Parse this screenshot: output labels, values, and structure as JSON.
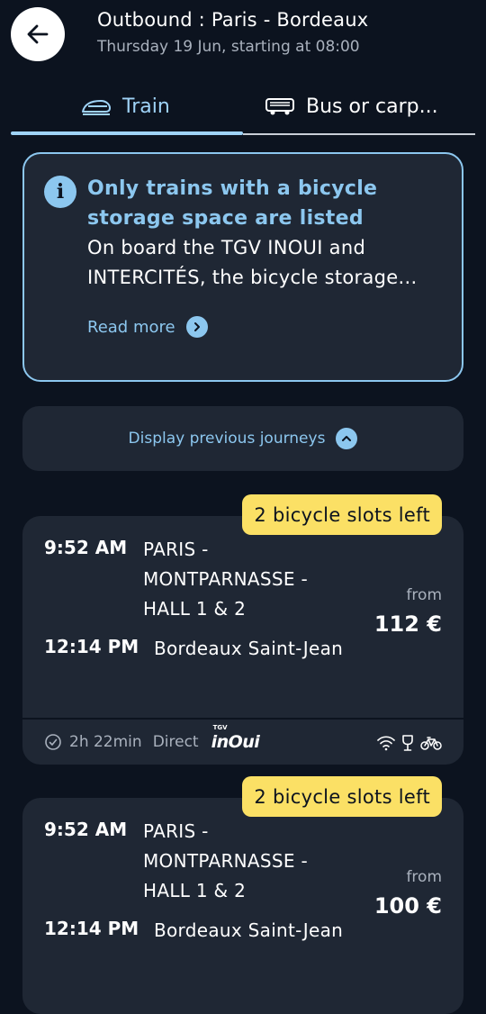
{
  "header": {
    "title": "Outbound : Paris - Bordeaux",
    "subtitle": "Thursday 19 Jun, starting at 08:00"
  },
  "tabs": [
    {
      "label": "Train",
      "icon": "train-icon",
      "active": true
    },
    {
      "label": "Bus or carp...",
      "icon": "bus-icon",
      "active": false
    }
  ],
  "info": {
    "title": "Only trains with a bicycle storage space are listed",
    "body": "On board the TGV INOUI and INTERCITÉS, the bicycle storage...",
    "read_more": "Read more"
  },
  "previous_journeys_label": "Display previous journeys",
  "journeys": [
    {
      "badge": "2 bicycle slots left",
      "departure_time": "9:52 AM",
      "departure_station": "PARIS - MONTPARNASSE - HALL 1 & 2",
      "arrival_time": "12:14 PM",
      "arrival_station": "Bordeaux Saint-Jean",
      "from_label": "from",
      "price": "112 €",
      "duration": "2h 22min",
      "connection": "Direct",
      "operator_small": "TGV",
      "operator": "inOui",
      "amenities": [
        "wifi-icon",
        "bar-icon",
        "bicycle-icon"
      ]
    },
    {
      "badge": "2 bicycle slots left",
      "departure_time": "9:52 AM",
      "departure_station": "PARIS - MONTPARNASSE - HALL 1 & 2",
      "arrival_time": "12:14 PM",
      "arrival_station": "Bordeaux Saint-Jean",
      "from_label": "from",
      "price": "100 €"
    }
  ],
  "colors": {
    "background": "#0c131f",
    "card": "#1f2734",
    "accent": "#8cc7ef",
    "badge": "#fbe065"
  }
}
